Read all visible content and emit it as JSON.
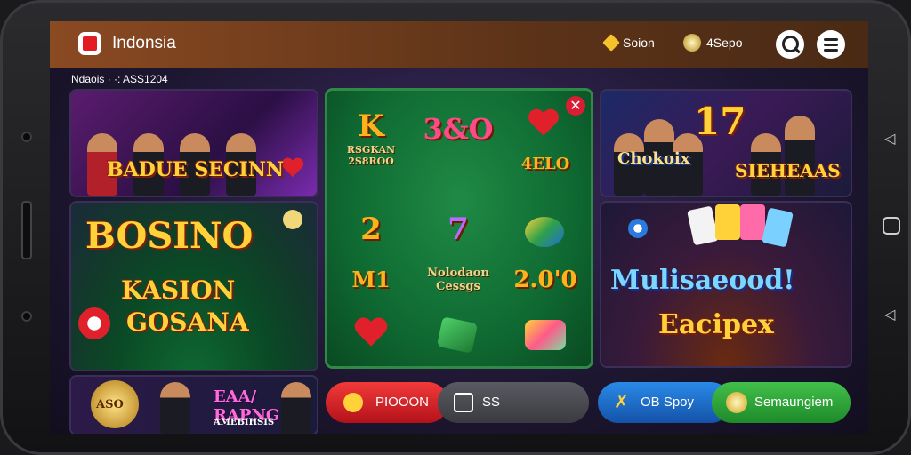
{
  "header": {
    "title": "Indonsia",
    "coins_label": "Soion",
    "gems_label": "4Sepo"
  },
  "subheader": {
    "text": "Ndaois · ·: ASS1204"
  },
  "tiles": {
    "top_left_caption": "BADUE SECINN",
    "left_big_line1": "BOSINO",
    "left_big_line2": "KASION",
    "left_big_line3": "GOSANA",
    "left_bottom_badge": "ASO",
    "left_bottom_title": "EAA/ RAPNG",
    "left_bottom_sub": "AMEBIHSIS",
    "center_grid": [
      {
        "big": "K",
        "sub": "RSGKAN\n2S8ROO"
      },
      {
        "big": "3&O",
        "sub": ""
      },
      {
        "big": "",
        "sub": "4ELO"
      },
      {
        "big": "2",
        "sub": ""
      },
      {
        "big": "7",
        "sub": ""
      },
      {
        "big": "",
        "sub": ""
      },
      {
        "big": "M1",
        "sub": ""
      },
      {
        "big": "",
        "sub": "Nolodaon\nCessgs"
      },
      {
        "big": "2.0'0",
        "sub": ""
      }
    ],
    "top_right_left_caption": "Chokoix",
    "top_right_number": "17",
    "top_right_caption": "SIEHEAAS",
    "right_big_line1": "Mulisaeood!",
    "right_big_line2": "Eacipex"
  },
  "actions": {
    "red_label": "PIOOON",
    "gray_label": "SS",
    "blue_label": "OB Spoy",
    "green_label": "Semaungiem"
  },
  "colors": {
    "accent_red": "#e31b23",
    "top_bar": "#7a3f1d",
    "green_felt": "#0f6a32",
    "gold": "#ffd23a"
  },
  "icons": [
    "search-icon",
    "menu-icon",
    "close-icon",
    "back-nav-icon",
    "home-nav-icon"
  ]
}
